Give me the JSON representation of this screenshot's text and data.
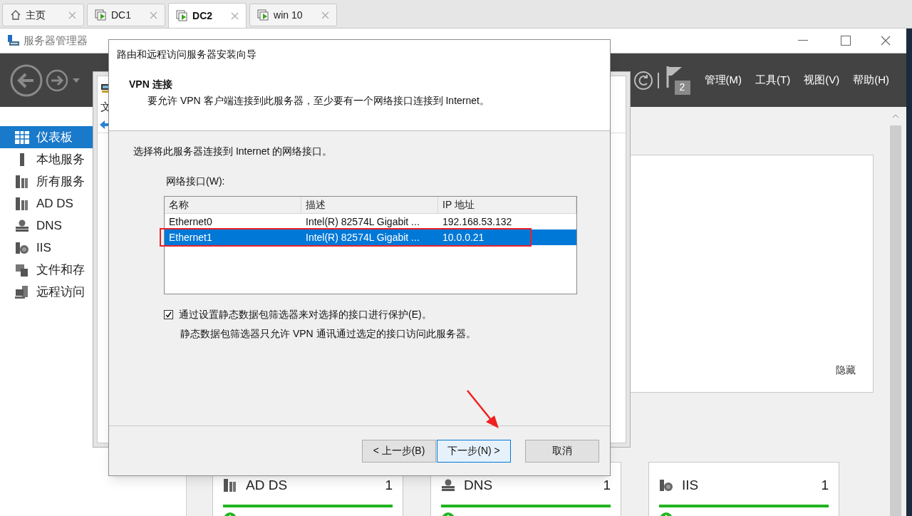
{
  "browser_tabs": [
    {
      "label": "主页",
      "kind": "home",
      "selected": false
    },
    {
      "label": "DC1",
      "kind": "vm",
      "selected": false
    },
    {
      "label": "DC2",
      "kind": "vm",
      "selected": true
    },
    {
      "label": "win 10",
      "kind": "vm",
      "selected": false
    }
  ],
  "server_manager": {
    "title": "服务器管理器",
    "notification_count": "2",
    "menu": [
      "管理(M)",
      "工具(T)",
      "视图(V)",
      "帮助(H)"
    ],
    "sidebar": [
      {
        "label": "仪表板",
        "kind": "dashboard",
        "selected": true
      },
      {
        "label": "本地服务",
        "kind": "server",
        "selected": false
      },
      {
        "label": "所有服务",
        "kind": "servers",
        "selected": false
      },
      {
        "label": "AD DS",
        "kind": "servers",
        "selected": false
      },
      {
        "label": "DNS",
        "kind": "dns",
        "selected": false
      },
      {
        "label": "IIS",
        "kind": "iis",
        "selected": false
      },
      {
        "label": "文件和存",
        "kind": "files",
        "selected": false
      },
      {
        "label": "远程访问",
        "kind": "remote",
        "selected": false
      }
    ],
    "hide_label": "隐藏",
    "tiles": [
      {
        "title": "AD DS",
        "count": "1",
        "kind": "servers"
      },
      {
        "title": "DNS",
        "count": "1",
        "kind": "dns"
      },
      {
        "title": "IIS",
        "count": "1",
        "kind": "iis"
      }
    ]
  },
  "background_window": {
    "menu_fragment": "文"
  },
  "dialog": {
    "title": "路由和远程访问服务器安装向导",
    "heading": "VPN 连接",
    "subtitle": "要允许 VPN 客户端连接到此服务器，至少要有一个网络接口连接到 Internet。",
    "instruction": "选择将此服务器连接到 Internet 的网络接口。",
    "list_label": "网络接口(W):",
    "columns": [
      "名称",
      "描述",
      "IP 地址"
    ],
    "rows": [
      {
        "cells": [
          "Ethernet0",
          "Intel(R) 82574L Gigabit ...",
          "192.168.53.132"
        ],
        "selected": false
      },
      {
        "cells": [
          "Ethernet1",
          "Intel(R) 82574L Gigabit ...",
          "10.0.0.21"
        ],
        "selected": true
      }
    ],
    "checkbox": {
      "label": "通过设置静态数据包筛选器来对选择的接口进行保护(E)。",
      "checked": true
    },
    "note": "静态数据包筛选器只允许 VPN 通讯通过选定的接口访问此服务器。",
    "buttons": [
      {
        "label": "< 上一步(B)",
        "focused": false
      },
      {
        "label": "下一步(N) >",
        "focused": true
      },
      {
        "label": "取消",
        "focused": false
      }
    ]
  }
}
